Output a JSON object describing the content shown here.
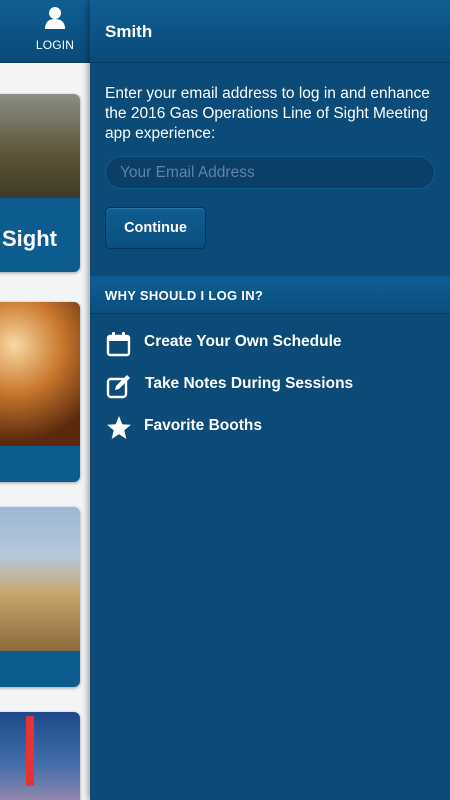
{
  "background_view": {
    "login_label": "LOGIN",
    "card_title_partial": "Sight"
  },
  "drawer": {
    "header_name": "Smith",
    "intro_text": "Enter your email address to log in and enhance the 2016 Gas Operations Line of Sight Meeting app experience:",
    "email_placeholder": "Your Email Address",
    "email_value": "",
    "continue_label": "Continue",
    "section_title": "WHY SHOULD I LOG IN?",
    "benefits": [
      {
        "icon": "calendar-icon",
        "label": "Create Your Own Schedule"
      },
      {
        "icon": "edit-icon",
        "label": "Take Notes During Sessions"
      },
      {
        "icon": "star-icon",
        "label": "Favorite Booths"
      }
    ]
  },
  "colors": {
    "drawer_bg": "#0c4a78",
    "header_gradient_top": "#0f5e93",
    "header_gradient_bottom": "#0a4a78",
    "text": "#ffffff",
    "input_bg": "#0b3f67",
    "placeholder": "#5f84a5"
  }
}
